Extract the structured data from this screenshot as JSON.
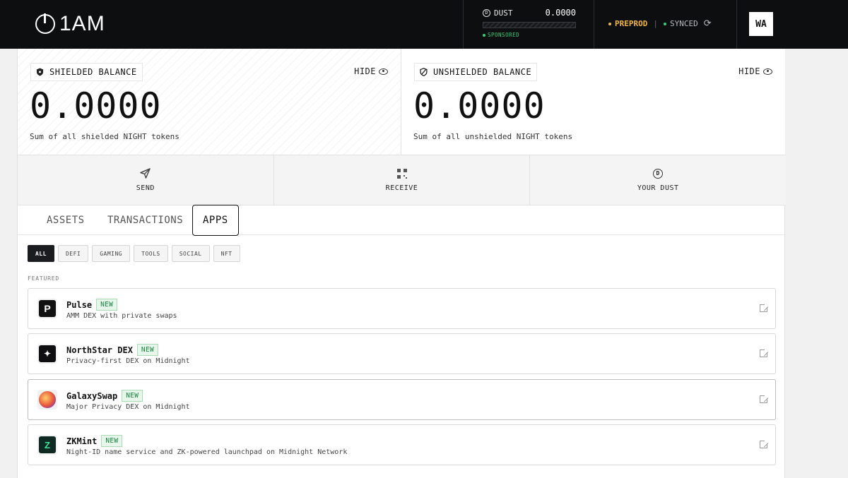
{
  "header": {
    "logo_text": "1AM",
    "dust": {
      "label": "DUST",
      "value": "0.0000",
      "sponsored": "SPONSORED"
    },
    "network": "PREPROD",
    "separator": "|",
    "sync_status": "SYNCED",
    "avatar_initials": "WA"
  },
  "balances": {
    "shielded": {
      "title": "SHIELDED BALANCE",
      "hide_label": "HIDE",
      "value": "0.0000",
      "caption": "Sum of all shielded NIGHT tokens"
    },
    "unshielded": {
      "title": "UNSHIELDED BALANCE",
      "hide_label": "HIDE",
      "value": "0.0000",
      "caption": "Sum of all unshielded NIGHT tokens"
    }
  },
  "actions": [
    {
      "label": "SEND",
      "icon": "send-icon"
    },
    {
      "label": "RECEIVE",
      "icon": "qr-code-icon"
    },
    {
      "label": "YOUR DUST",
      "icon": "dust-icon"
    }
  ],
  "tabs": [
    {
      "label": "ASSETS",
      "active": false
    },
    {
      "label": "TRANSACTIONS",
      "active": false
    },
    {
      "label": "APPS",
      "active": true
    }
  ],
  "filters": [
    {
      "label": "ALL",
      "active": true
    },
    {
      "label": "DEFI",
      "active": false
    },
    {
      "label": "GAMING",
      "active": false
    },
    {
      "label": "TOOLS",
      "active": false
    },
    {
      "label": "SOCIAL",
      "active": false
    },
    {
      "label": "NFT",
      "active": false
    }
  ],
  "featured_label": "FEATURED",
  "apps": [
    {
      "name": "Pulse",
      "badge": "NEW",
      "description": "AMM DEX with private swaps",
      "icon": "pulse-logo"
    },
    {
      "name": "NorthStar DEX",
      "badge": "NEW",
      "description": "Privacy-first DEX on Midnight",
      "icon": "northstar-logo"
    },
    {
      "name": "GalaxySwap",
      "badge": "NEW",
      "description": "Major Privacy DEX on Midnight",
      "icon": "galaxyswap-logo"
    },
    {
      "name": "ZKMint",
      "badge": "NEW",
      "description": "Night-ID name service and ZK-powered launchpad on Midnight Network",
      "icon": "zkmint-logo"
    }
  ],
  "colors": {
    "accent_green": "#2fd17a",
    "preprod": "#f3b53b",
    "badge_green": "#17823f"
  }
}
